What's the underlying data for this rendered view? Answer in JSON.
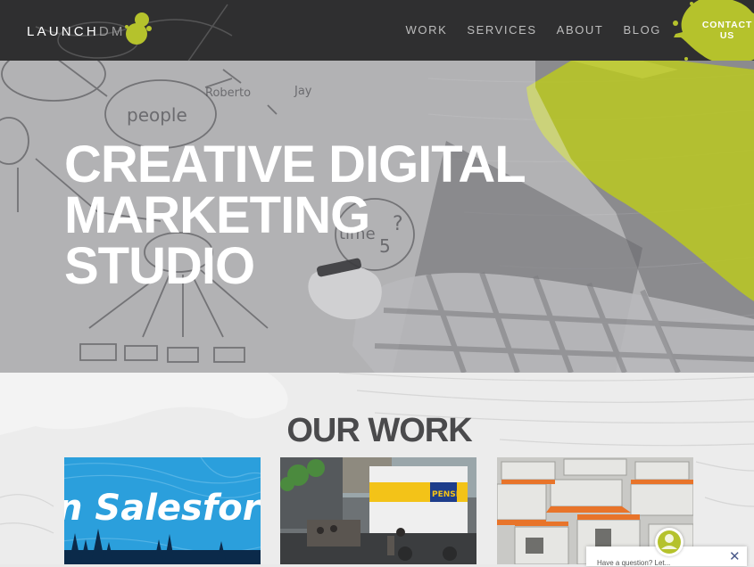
{
  "colors": {
    "header_bg": "#2f2f30",
    "accent_lime": "#b5c22c",
    "hero_overlay": "#8d8d90",
    "white": "#ffffff",
    "work_title": "#4a4a4c"
  },
  "header": {
    "logo": {
      "part1": "LAUNCH",
      "part2": "DM",
      "mark": "green-splat-logo"
    },
    "nav": [
      "WORK",
      "SERVICES",
      "ABOUT",
      "BLOG"
    ],
    "contact": {
      "line1": "CONTACT",
      "line2": "US",
      "shape": "lime-paint-splat"
    }
  },
  "hero": {
    "title_lines": [
      "CREATIVE DIGITAL",
      "MARKETING",
      "STUDIO"
    ],
    "handwritten_words": [
      "people",
      "Roberto",
      "Jay",
      "time",
      "?",
      "5"
    ]
  },
  "work": {
    "title": "OUR WORK",
    "tiles": [
      {
        "id": "salesforce",
        "label": "n Salesfor",
        "icon": "salesforce-project-image"
      },
      {
        "id": "penske",
        "label": "PENSKE",
        "icon": "penske-truck-project-image"
      },
      {
        "id": "office",
        "label": "",
        "icon": "office-cubicles-project-image"
      }
    ]
  },
  "chat": {
    "icon": "chat-avatar-icon",
    "text": "Have a question? Let...",
    "close": "✕"
  }
}
